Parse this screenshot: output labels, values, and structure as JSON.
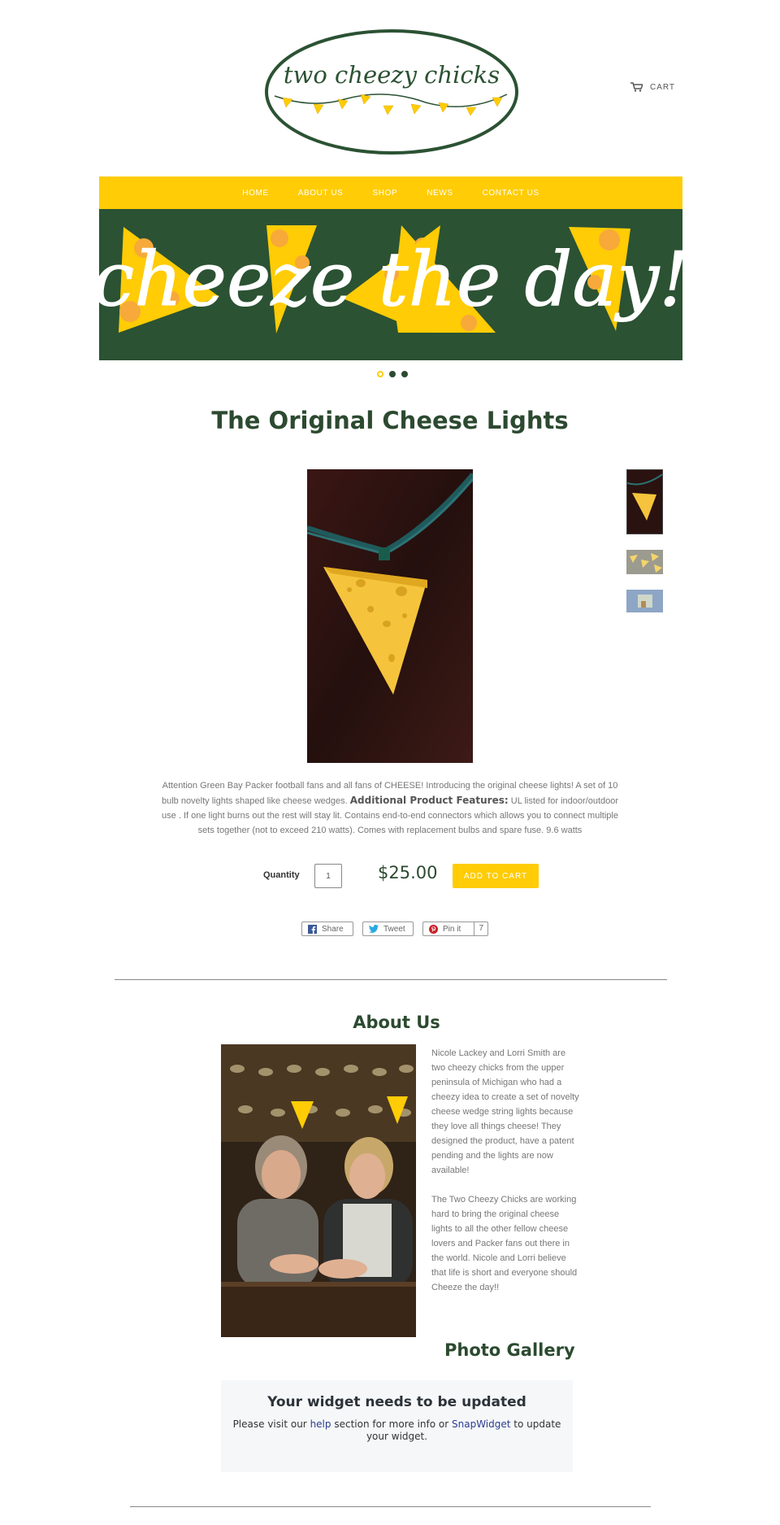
{
  "header": {
    "logo_text": "two cheezy chicks",
    "cart_label": "CART"
  },
  "nav": {
    "items": [
      "HOME",
      "ABOUT US",
      "SHOP",
      "NEWS",
      "CONTACT US"
    ]
  },
  "banner": {
    "text": "cheeze the day!",
    "slide_count": 3,
    "active_slide": 1
  },
  "product": {
    "title": "The Original Cheese Lights",
    "description_intro": "Attention Green Bay Packer football fans and all fans of CHEESE! Introducing the original cheese lights! A set of 10 bulb novelty lights shaped like cheese wedges.",
    "features_label": "Additional Product Features:",
    "description_features": " UL listed for indoor/outdoor use .  If one light burns out the rest will stay lit.  Contains end-to-end connectors which allows you to connect multiple sets together (not to exceed 210 watts).  Comes with replacement bulbs and spare fuse.  9.6 watts",
    "quantity_label": "Quantity",
    "quantity_value": "1",
    "price": "$25.00",
    "add_to_cart_label": "ADD TO CART"
  },
  "share": {
    "facebook_label": "Share",
    "twitter_label": "Tweet",
    "pinterest_label": "Pin it",
    "pinterest_count": "7"
  },
  "about": {
    "title": "About Us",
    "paragraph1": "Nicole Lackey and Lorri Smith are two cheezy chicks from the upper peninsula of Michigan who had a cheezy idea to create a set of novelty cheese wedge string lights because they love all things cheese! They designed the product, have a patent pending and the lights are now available!",
    "paragraph2": "The Two Cheezy Chicks are working hard to bring the original cheese lights to all the other fellow cheese lovers and Packer fans out there in the world.  Nicole and Lorri believe that life is short and everyone should Cheeze the day!!"
  },
  "gallery": {
    "title": "Photo Gallery",
    "widget_title": "Your widget needs to be updated",
    "widget_text_before": "Please visit our ",
    "widget_link1": "help",
    "widget_text_middle": " section for more info or ",
    "widget_link2": "SnapWidget",
    "widget_text_after": " to update your widget."
  },
  "colors": {
    "brand_yellow": "#ffcc05",
    "brand_green": "#2b5233",
    "title_green": "#2c4a30"
  },
  "icons": [
    "cart-icon",
    "facebook-icon",
    "twitter-icon",
    "pinterest-icon"
  ]
}
